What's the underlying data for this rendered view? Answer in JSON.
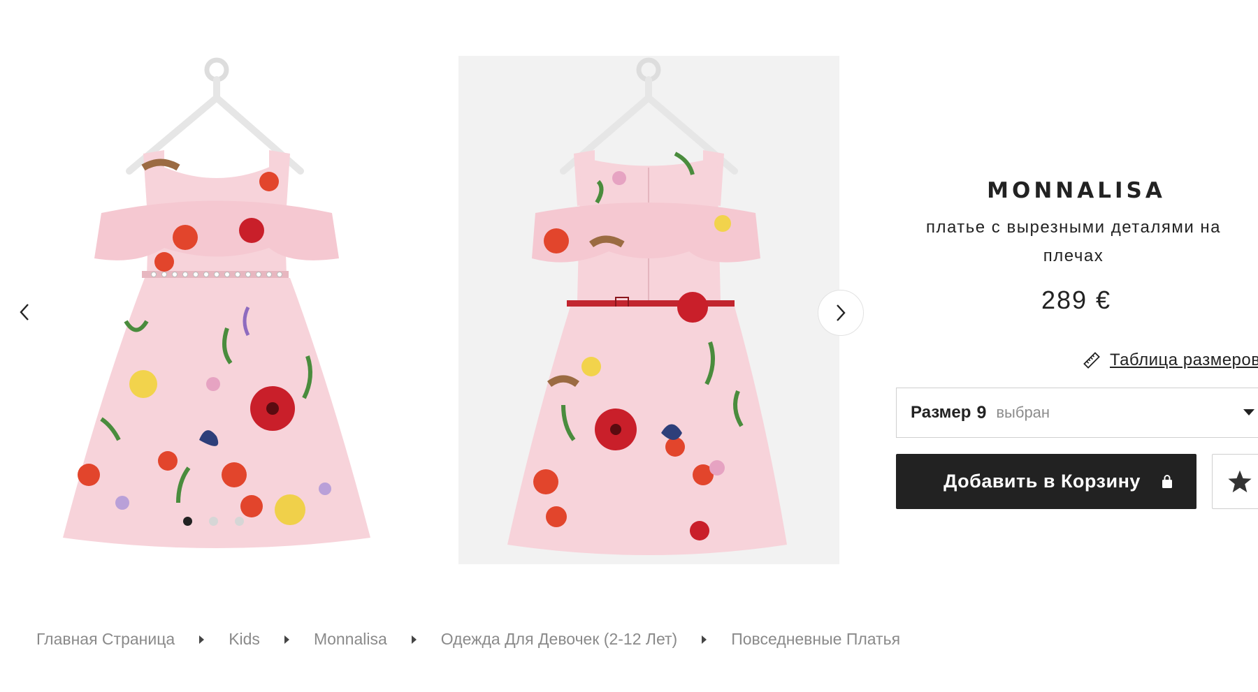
{
  "product": {
    "brand": "MONNALISA",
    "name": "платье с вырезными деталями на плечах",
    "price": "289 €"
  },
  "size_guide": {
    "label": "Таблица размеров",
    "icon": "ruler-icon"
  },
  "size_selector": {
    "label": "Размер",
    "value": "9",
    "state": "выбран"
  },
  "actions": {
    "add_to_cart": "Добавить в Корзину",
    "add_to_cart_icon": "bag-icon",
    "wishlist_icon": "star-icon"
  },
  "gallery": {
    "prev_icon": "chevron-left-icon",
    "next_icon": "chevron-right-icon",
    "slide_count": 3,
    "active_slide": 1
  },
  "breadcrumb": [
    "Главная Страница",
    "Kids",
    "Monnalisa",
    "Одежда Для Девочек (2-12 Лет)",
    "Повседневные Платья"
  ],
  "colors": {
    "text": "#222222",
    "muted": "#8a8a8a",
    "button_bg": "#222222",
    "dress_pink": "#f7d3da",
    "belt_red": "#c2252f"
  }
}
